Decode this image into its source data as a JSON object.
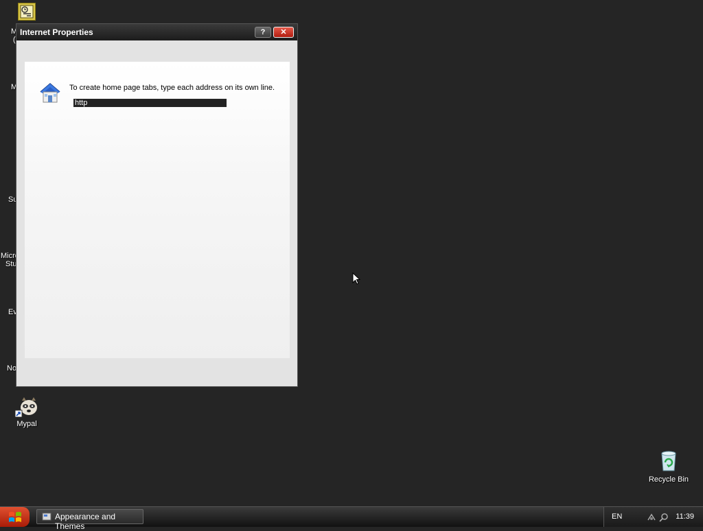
{
  "desktop": {
    "icons": [
      {
        "label": "Mypal"
      },
      {
        "label": "Recycle Bin"
      }
    ],
    "partial_labels": [
      "M",
      "(",
      "M",
      "Su",
      "Micro",
      "Stu",
      "Ev",
      "No"
    ]
  },
  "window": {
    "title": "Internet Properties",
    "help_label": "?",
    "close_label": "✕",
    "instruction": "To create home page tabs, type each address on its own line.",
    "url_value": "http"
  },
  "taskbar": {
    "task_button_label": "Appearance and Themes",
    "language": "EN",
    "clock": "11:39"
  }
}
